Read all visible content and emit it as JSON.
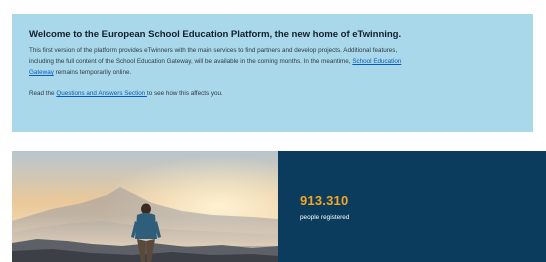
{
  "notice": {
    "title": "Welcome to the European School Education Platform, the new home of eTwinning.",
    "body_text": "This first version of the platform provides eTwinners with the main services to find partners and develop projects. Additional features, including the full content of the School Education Gateway, will be available in the coming months. In the meantime, ",
    "gateway_link": "School Education Gateway",
    "body_after_link": " remains temporarily online.",
    "footer_before_link": "Read the ",
    "qa_link": "Questions and Answers Section ",
    "footer_after_link": "to see how this affects you."
  },
  "stats": {
    "count": "913.310",
    "label": "people registered"
  },
  "colors": {
    "notice_background": "#a8d8ea",
    "stats_background": "#0b3c5d",
    "accent_number": "#f5a623",
    "link": "#0a5bbd"
  }
}
